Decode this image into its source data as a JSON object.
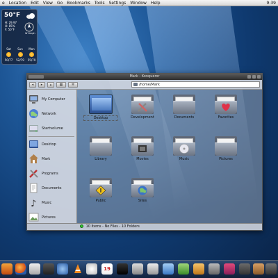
{
  "menubar": {
    "items": [
      "e",
      "Location",
      "Edit",
      "View",
      "Go",
      "Bookmarks",
      "Tools",
      "Settings",
      "Window",
      "Help"
    ],
    "clock": "9:39"
  },
  "weather": {
    "temperature": "50°F",
    "details": [
      "H: 29.97",
      "H: 85%",
      "F: 50°F"
    ],
    "wind_label": "W 6mph",
    "days": [
      {
        "name": "Sat",
        "range": "50/77"
      },
      {
        "name": "Sun",
        "range": "52/79"
      },
      {
        "name": "Mon",
        "range": "55/79"
      }
    ]
  },
  "window": {
    "title": "Mark - Konqueror",
    "path": "/home/Mark",
    "toolbar": {
      "back": "◂",
      "forward": "▸",
      "up": "▴",
      "view": "▦",
      "gear": "✲"
    },
    "sidebar": {
      "group1": [
        "My Computer",
        "Network",
        "Startvolume"
      ],
      "group2": [
        "Desktop",
        "Mark",
        "Programs",
        "Documents",
        "Music",
        "Pictures"
      ]
    },
    "files": [
      {
        "label": "Desktop"
      },
      {
        "label": "Development"
      },
      {
        "label": "Documents"
      },
      {
        "label": "Favorites"
      },
      {
        "label": "Library"
      },
      {
        "label": "Movies"
      },
      {
        "label": "Music"
      },
      {
        "label": "Pictures"
      },
      {
        "label": "Public"
      },
      {
        "label": "Sites"
      }
    ],
    "status": "10 Items - No Files - 10 Folders"
  },
  "dock": {
    "calendar_day": "19"
  }
}
